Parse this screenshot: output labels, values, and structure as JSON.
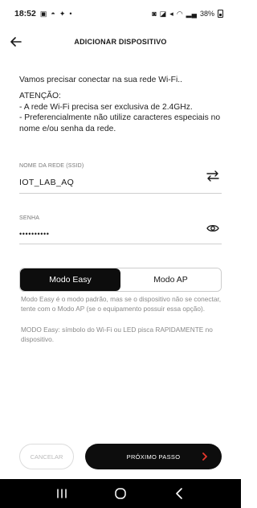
{
  "status_bar": {
    "time": "18:52",
    "battery": "38%"
  },
  "header": {
    "title": "ADICIONAR DISPOSITIVO"
  },
  "intro": "Vamos precisar conectar na sua rede Wi-Fi..",
  "warning": {
    "heading": "ATENÇÃO:",
    "line1": "- A rede Wi-Fi precisa ser exclusiva de 2.4GHz.",
    "line2": "- Preferencialmente não utilize caracteres especiais no nome e/ou senha da rede."
  },
  "network": {
    "ssid_label": "NOME DA REDE (SSID)",
    "ssid_value": "IOT_LAB_AQ",
    "password_label": "SENHA",
    "password_value": "••••••••••"
  },
  "modes": {
    "easy_label": "Modo Easy",
    "ap_label": "Modo AP",
    "selected": "Modo Easy",
    "description1": "Modo Easy é o modo padrão, mas se o dispositivo não se conectar, tente com o Modo AP (se o equipamento possuir essa opção).",
    "description2": "MODO Easy: símbolo do Wi-Fi ou LED pisca RAPIDAMENTE no dispositivo."
  },
  "actions": {
    "cancel_label": "CANCELAR",
    "next_label": "PRÓXIMO PASSO"
  },
  "colors": {
    "primary": "#0d0d0d",
    "accent_arrow": "#e8372c",
    "muted_text": "#8a8a8a"
  },
  "icons": {
    "back": "arrow-left-icon",
    "swap": "swap-arrows-icon",
    "visibility": "eye-icon",
    "next": "chevron-right-icon",
    "nav_recents": "recents-icon",
    "nav_home": "home-icon",
    "nav_back": "nav-back-icon"
  }
}
